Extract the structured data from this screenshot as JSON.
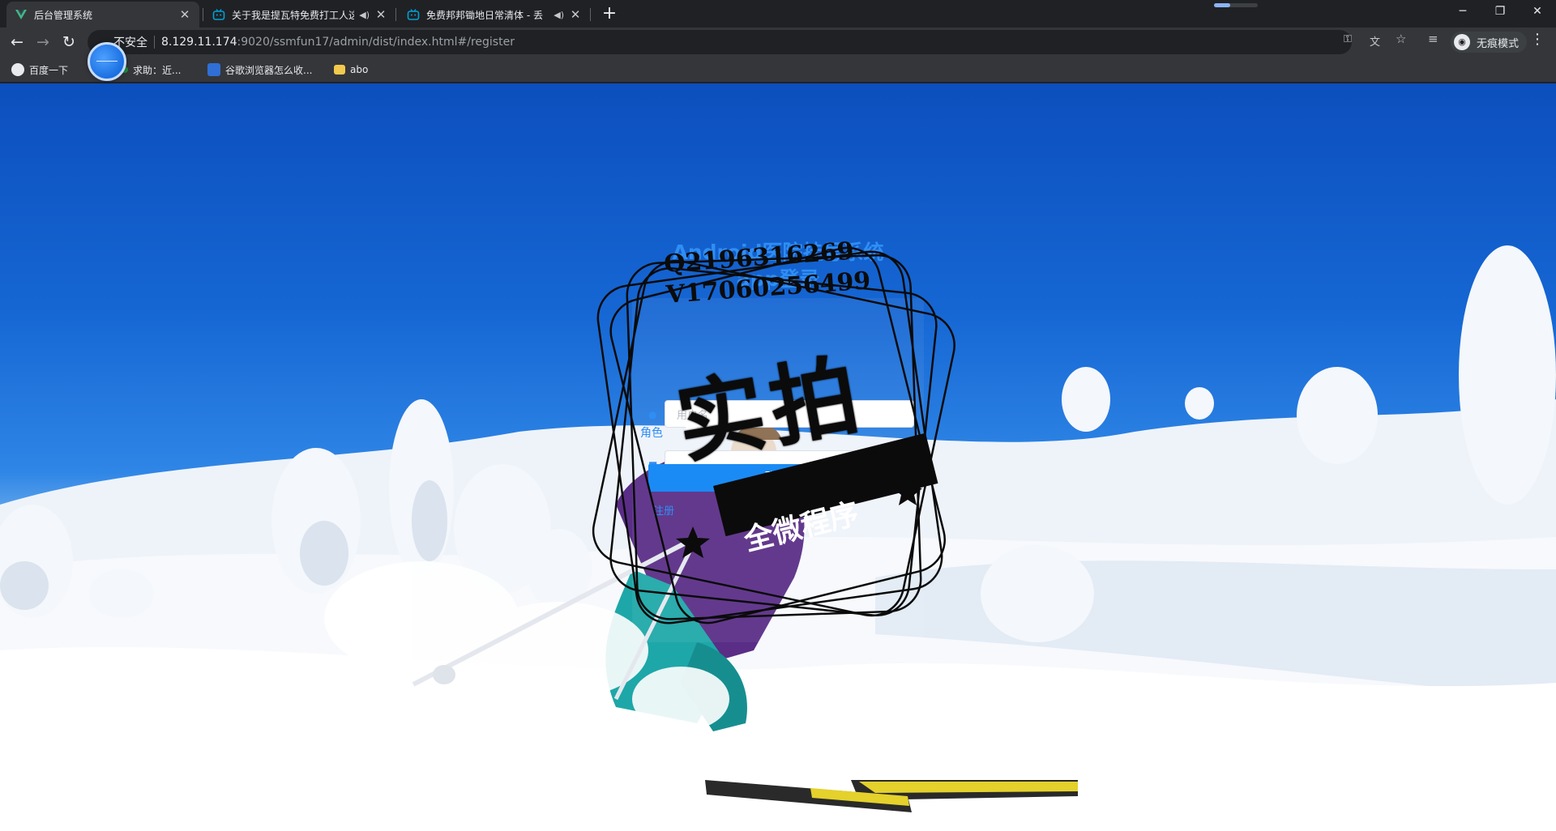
{
  "tabs": [
    {
      "title": "后台管理系统",
      "active": true,
      "icon": "vue-logo-icon"
    },
    {
      "title": "关于我是提瓦特免费打工人这",
      "active": false,
      "icon": "bilibili-icon"
    },
    {
      "title": "免费邦邦锄地日常清体 - 丢",
      "active": false,
      "icon": "bilibili-icon"
    }
  ],
  "browser": {
    "security_label": "不安全",
    "url_host": "8.129.11.174",
    "url_path": ":9020/ssmfun17/admin/dist/index.html#/register",
    "profile_label": "无痕模式"
  },
  "bookmarks": [
    {
      "label": "百度一下",
      "icon": "baidu-icon"
    },
    {
      "label": "求助：近...",
      "icon": "bookmark-icon"
    },
    {
      "label": "谷歌浏览器怎么收...",
      "icon": "baidu-paw-icon"
    },
    {
      "label": "abo",
      "icon": "folder-icon"
    }
  ],
  "login": {
    "title_line1": "Android医院挂号系统",
    "title_line2": "app登录",
    "username_placeholder": "用户名",
    "password_placeholder": "",
    "role_label": "角色",
    "role_option": "管理员",
    "login_button": "登录",
    "register_link": "注册"
  },
  "watermark": {
    "qq": "Q2196316269",
    "vx": "V17060256499",
    "big_text": "实拍",
    "banner_text": "全微程序"
  },
  "colors": {
    "accent": "#1a8bf5",
    "sky": "#1566d3",
    "chrome_dark": "#202124",
    "chrome_toolbar": "#35363a"
  }
}
